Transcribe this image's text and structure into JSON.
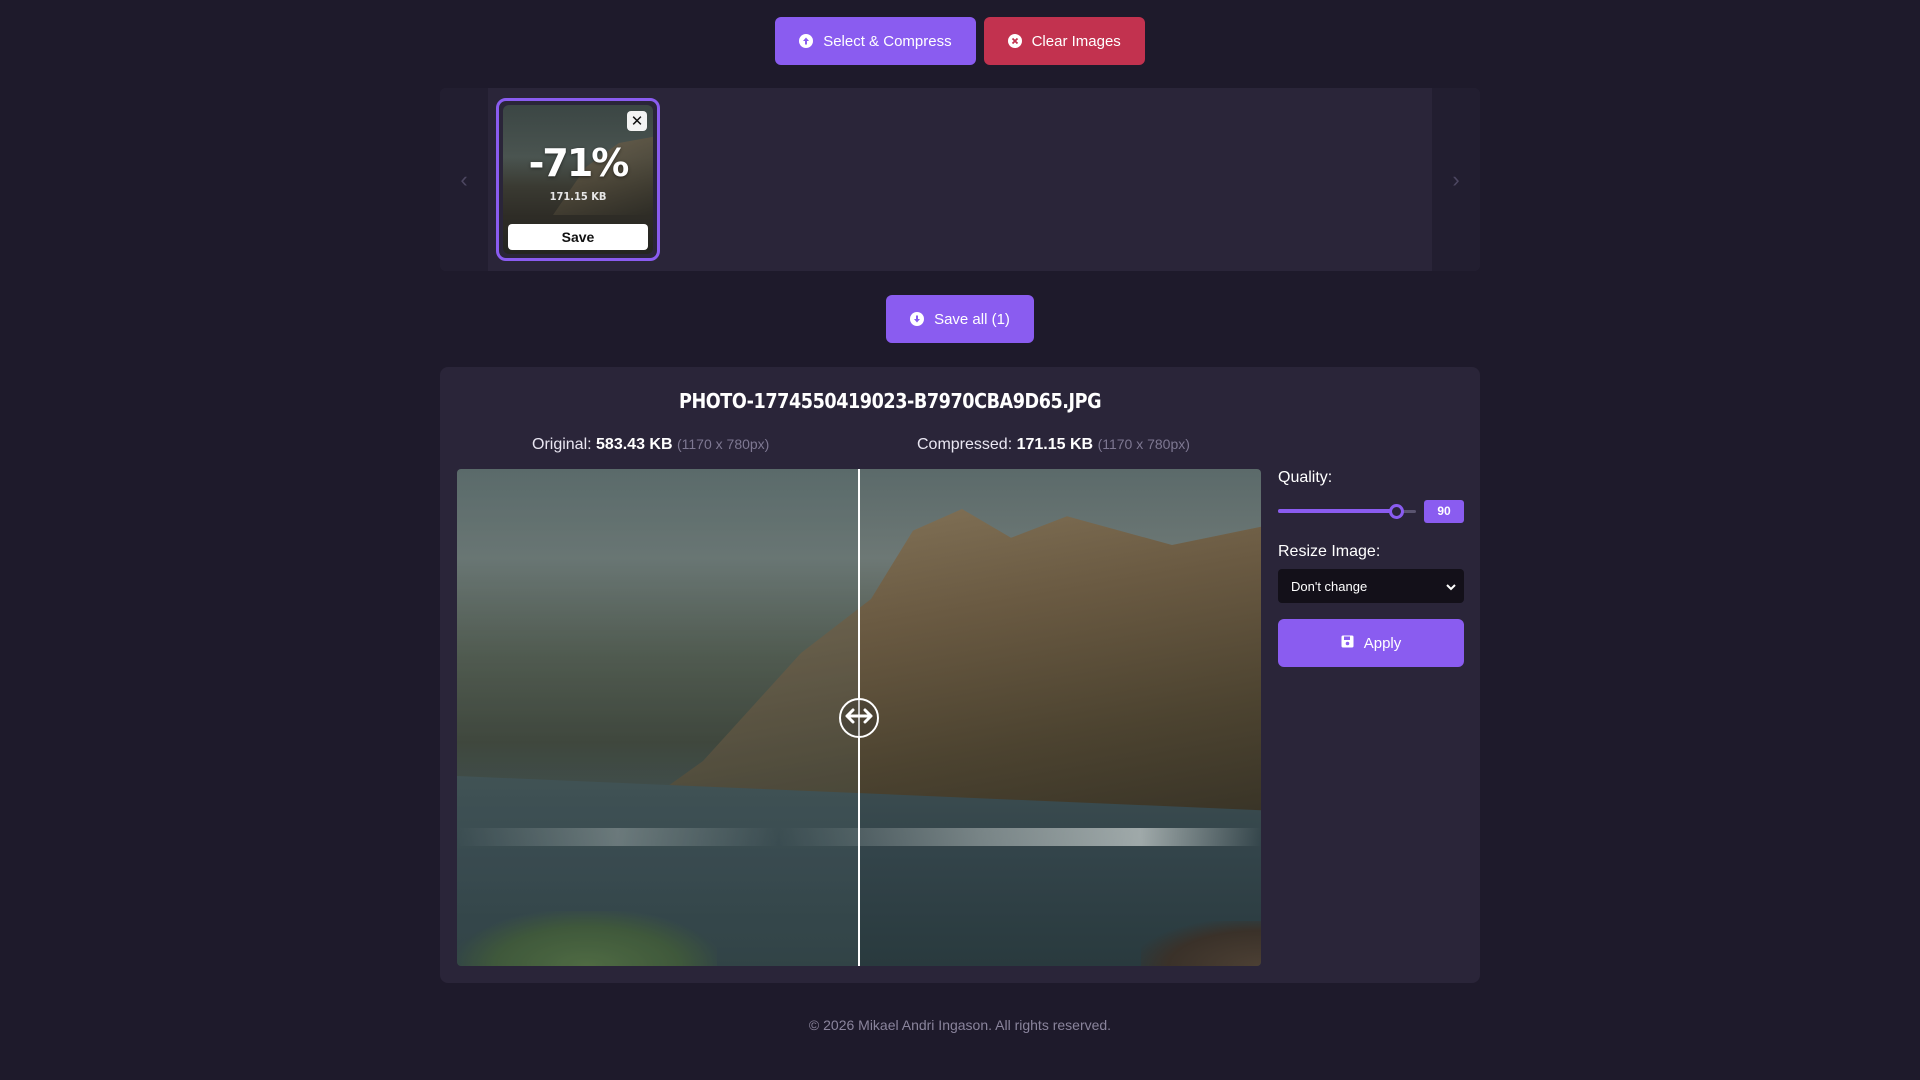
{
  "toolbar": {
    "select_label": "Select & Compress",
    "clear_label": "Clear Images",
    "primary_color": "#8a5cf0",
    "danger_color": "#c2324f"
  },
  "carousel": {
    "prev_icon": "chevron-left-icon",
    "next_icon": "chevron-right-icon",
    "items": [
      {
        "percent": "-71%",
        "size": "171.15 KB",
        "save_label": "Save"
      }
    ]
  },
  "save_all": {
    "label": "Save all (1)"
  },
  "preview": {
    "filename": "PHOTO-1774550419023-B7970CBA9D65.JPG",
    "original": {
      "label": "Original:",
      "size": "583.43 KB",
      "dims": "(1170 x 780px)"
    },
    "compressed": {
      "label": "Compressed:",
      "size": "171.15 KB",
      "dims": "(1170 x 780px)"
    },
    "divider_position": 0.5
  },
  "settings": {
    "quality_label": "Quality:",
    "quality_value": "90",
    "quality_fraction": 0.9,
    "resize_label": "Resize Image:",
    "resize_selected": "Don't change",
    "apply_label": "Apply"
  },
  "footer": {
    "text": "© 2026 Mikael Andri Ingason. All rights reserved."
  }
}
